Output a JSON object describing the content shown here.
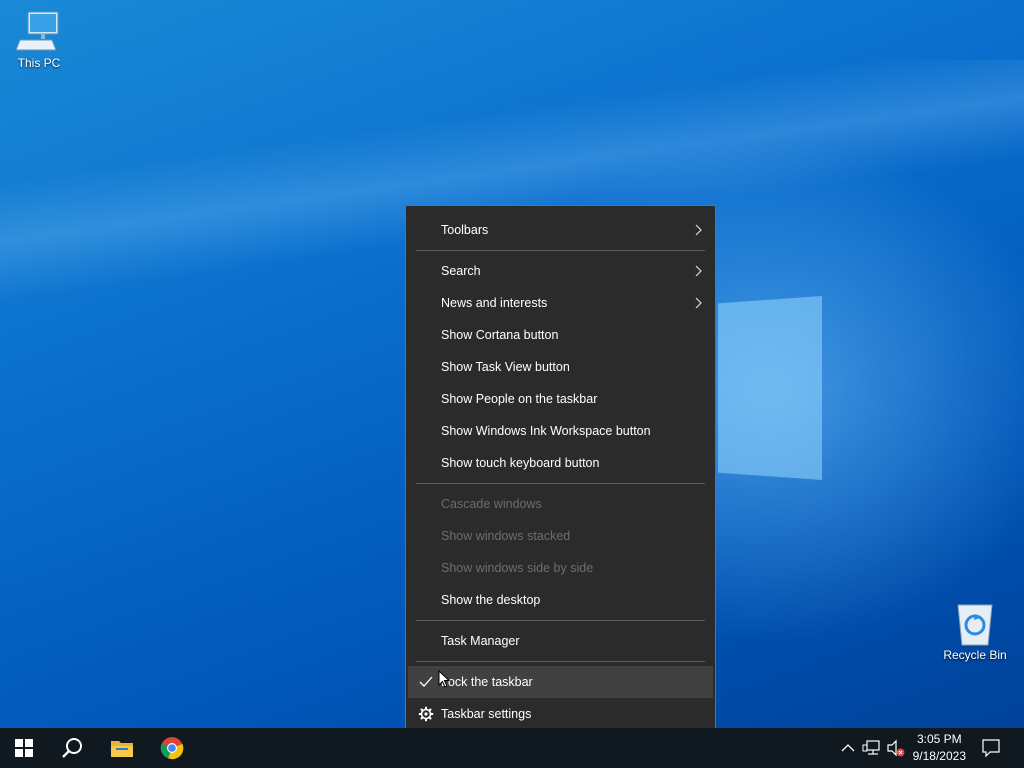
{
  "desktop": {
    "icons": [
      {
        "label": "This PC",
        "icon": "computer-icon"
      },
      {
        "label": "Recycle Bin",
        "icon": "recycle-bin-icon"
      }
    ]
  },
  "context_menu": {
    "items": [
      {
        "label": "Toolbars",
        "submenu": true
      },
      {
        "label": "Search",
        "submenu": true
      },
      {
        "label": "News and interests",
        "submenu": true
      },
      {
        "label": "Show Cortana button"
      },
      {
        "label": "Show Task View button"
      },
      {
        "label": "Show People on the taskbar"
      },
      {
        "label": "Show Windows Ink Workspace button"
      },
      {
        "label": "Show touch keyboard button"
      },
      {
        "label": "Cascade windows",
        "disabled": true
      },
      {
        "label": "Show windows stacked",
        "disabled": true
      },
      {
        "label": "Show windows side by side",
        "disabled": true
      },
      {
        "label": "Show the desktop"
      },
      {
        "label": "Task Manager"
      },
      {
        "label": "Lock the taskbar",
        "checked": true
      },
      {
        "label": "Taskbar settings",
        "icon": "gear-icon"
      }
    ]
  },
  "taskbar": {
    "pinned": [
      "start-icon",
      "search-icon",
      "file-explorer-icon",
      "chrome-icon"
    ],
    "tray": [
      "chevron-up-icon",
      "network-icon",
      "volume-muted-icon",
      "notification-icon"
    ],
    "time": "3:05 PM",
    "date": "9/18/2023"
  },
  "colors": {
    "menu_bg": "#2b2b2b",
    "menu_hover": "#414141",
    "taskbar_bg": "#101820",
    "desktop_accent": "#0a6fce"
  }
}
